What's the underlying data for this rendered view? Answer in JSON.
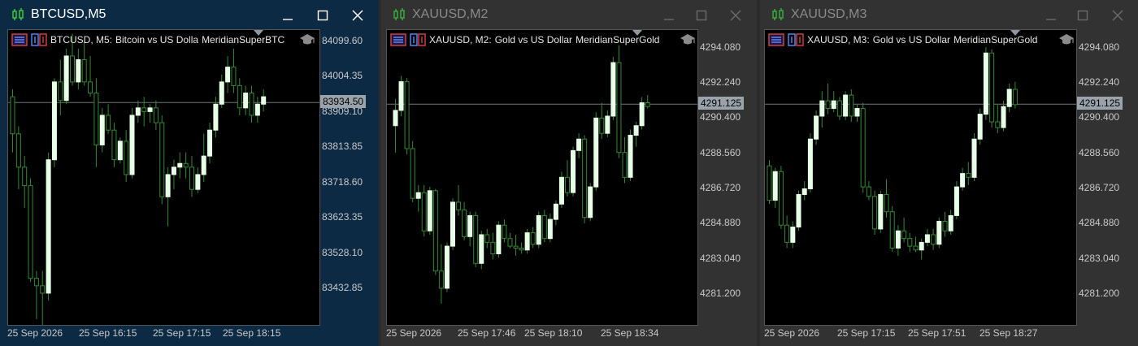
{
  "colors": {
    "active_title_bg": "#0d2a45",
    "inactive_title_bg": "#323232",
    "bull_candle": "#e8ffe8",
    "bear_candle": "#000000",
    "wick": "#2e8b2e",
    "price_line": "#6e7478",
    "price_tag_bg": "#9aa3ab"
  },
  "windows": [
    {
      "id": "btc",
      "title": "BTCUSD,M5",
      "active": true,
      "header": {
        "symbol": "BTCUSD, M5:",
        "description": "Bitcoin vs US Dolla",
        "indicator": "MeridianSuperBTC"
      },
      "price_ticks": [
        "84099.60",
        "84004.35",
        "83909.10",
        "83813.85",
        "83718.60",
        "83623.35",
        "83528.10",
        "83432.85"
      ],
      "current_price": "83934.50",
      "time_labels": [
        "25 Sep 2026",
        "25 Sep 16:15",
        "25 Sep 17:15",
        "25 Sep 18:15"
      ],
      "chart_data": {
        "type": "candlestick",
        "ylim": [
          83330,
          84130
        ],
        "current_price": 83934.5,
        "candles": [
          [
            83950,
            83970,
            83800,
            83850
          ],
          [
            83850,
            83870,
            83700,
            83760
          ],
          [
            83760,
            83790,
            83650,
            83710
          ],
          [
            83710,
            83730,
            83450,
            83460
          ],
          [
            83460,
            83480,
            83350,
            83440
          ],
          [
            83440,
            83480,
            83330,
            83420
          ],
          [
            83420,
            83800,
            83400,
            83780
          ],
          [
            83780,
            84000,
            83760,
            83990
          ],
          [
            83990,
            84050,
            83900,
            83940
          ],
          [
            83940,
            84080,
            83930,
            84060
          ],
          [
            84060,
            84120,
            83980,
            83990
          ],
          [
            83990,
            84080,
            83970,
            84050
          ],
          [
            84050,
            84100,
            83980,
            83990
          ],
          [
            83990,
            84060,
            83950,
            83960
          ],
          [
            83960,
            84000,
            83760,
            83820
          ],
          [
            83820,
            83920,
            83800,
            83900
          ],
          [
            83900,
            83930,
            83850,
            83860
          ],
          [
            83860,
            83880,
            83760,
            83780
          ],
          [
            83780,
            83840,
            83770,
            83830
          ],
          [
            83830,
            83860,
            83720,
            83740
          ],
          [
            83740,
            83920,
            83730,
            83900
          ],
          [
            83900,
            83940,
            83880,
            83920
          ],
          [
            83920,
            83950,
            83870,
            83910
          ],
          [
            83910,
            83930,
            83880,
            83920
          ],
          [
            83920,
            83940,
            83860,
            83880
          ],
          [
            83880,
            83900,
            83660,
            83680
          ],
          [
            83680,
            83760,
            83600,
            83740
          ],
          [
            83740,
            83780,
            83700,
            83760
          ],
          [
            83760,
            83800,
            83730,
            83770
          ],
          [
            83770,
            83800,
            83730,
            83760
          ],
          [
            83760,
            83790,
            83680,
            83700
          ],
          [
            83700,
            83760,
            83690,
            83740
          ],
          [
            83740,
            83850,
            83720,
            83790
          ],
          [
            83790,
            83880,
            83770,
            83860
          ],
          [
            83860,
            83950,
            83840,
            83930
          ],
          [
            83930,
            84010,
            83920,
            83990
          ],
          [
            83990,
            84060,
            83960,
            84030
          ],
          [
            84030,
            84080,
            83960,
            83980
          ],
          [
            83980,
            84000,
            83900,
            83920
          ],
          [
            83920,
            83980,
            83900,
            83960
          ],
          [
            83960,
            83980,
            83880,
            83900
          ],
          [
            83900,
            83950,
            83880,
            83930
          ],
          [
            83930,
            83970,
            83910,
            83950
          ]
        ]
      }
    },
    {
      "id": "xau2",
      "title": "XAUUSD,M2",
      "active": false,
      "header": {
        "symbol": "XAUUSD, M2:",
        "description": "Gold vs US Dollar",
        "indicator": "MeridianSuperGold"
      },
      "price_ticks": [
        "4294.080",
        "4292.240",
        "4290.400",
        "4288.560",
        "4286.720",
        "4284.880",
        "4283.040",
        "4281.200"
      ],
      "current_price": "4291.125",
      "time_labels": [
        "25 Sep 2026",
        "25 Sep 17:46",
        "25 Sep 18:10",
        "25 Sep 18:34"
      ],
      "chart_data": {
        "type": "candlestick",
        "ylim": [
          4279.5,
          4295.0
        ],
        "current_price": 4291.125,
        "candles": [
          [
            4290.0,
            4291.4,
            4288.6,
            4290.8
          ],
          [
            4290.8,
            4292.6,
            4290.5,
            4292.3
          ],
          [
            4292.3,
            4292.5,
            4288.5,
            4288.8
          ],
          [
            4288.8,
            4289.2,
            4286.0,
            4286.2
          ],
          [
            4286.2,
            4286.9,
            4285.5,
            4286.5
          ],
          [
            4286.5,
            4286.9,
            4284.2,
            4284.5
          ],
          [
            4284.5,
            4286.8,
            4284.3,
            4286.6
          ],
          [
            4286.6,
            4286.7,
            4282.2,
            4282.4
          ],
          [
            4282.4,
            4283.8,
            4280.7,
            4281.5
          ],
          [
            4281.5,
            4283.9,
            4281.3,
            4283.7
          ],
          [
            4283.7,
            4286.2,
            4283.5,
            4286.0
          ],
          [
            4286.0,
            4286.9,
            4285.3,
            4285.6
          ],
          [
            4285.6,
            4286.0,
            4284.0,
            4284.2
          ],
          [
            4284.2,
            4285.5,
            4283.7,
            4285.3
          ],
          [
            4285.3,
            4285.5,
            4282.6,
            4282.8
          ],
          [
            4282.8,
            4284.5,
            4282.5,
            4284.3
          ],
          [
            4284.3,
            4284.6,
            4283.6,
            4283.9
          ],
          [
            4283.9,
            4284.4,
            4283.0,
            4283.3
          ],
          [
            4283.3,
            4285.0,
            4283.1,
            4284.8
          ],
          [
            4284.8,
            4285.1,
            4283.9,
            4284.1
          ],
          [
            4284.1,
            4284.4,
            4283.6,
            4283.7
          ],
          [
            4283.7,
            4284.3,
            4283.2,
            4283.6
          ],
          [
            4283.6,
            4283.9,
            4283.3,
            4283.5
          ],
          [
            4283.5,
            4284.6,
            4283.3,
            4284.4
          ],
          [
            4284.4,
            4284.7,
            4283.6,
            4283.8
          ],
          [
            4283.8,
            4285.5,
            4283.6,
            4285.3
          ],
          [
            4285.3,
            4285.6,
            4283.9,
            4284.1
          ],
          [
            4284.1,
            4285.4,
            4283.9,
            4285.1
          ],
          [
            4285.1,
            4286.1,
            4284.8,
            4285.9
          ],
          [
            4285.9,
            4287.6,
            4285.7,
            4287.3
          ],
          [
            4287.3,
            4288.2,
            4286.3,
            4286.5
          ],
          [
            4286.5,
            4288.9,
            4286.3,
            4288.7
          ],
          [
            4288.7,
            4289.6,
            4288.3,
            4289.3
          ],
          [
            4289.3,
            4289.5,
            4284.9,
            4285.2
          ],
          [
            4285.2,
            4287.0,
            4285.0,
            4286.8
          ],
          [
            4286.8,
            4290.7,
            4286.6,
            4290.4
          ],
          [
            4290.4,
            4291.2,
            4289.3,
            4289.6
          ],
          [
            4289.6,
            4290.8,
            4289.4,
            4290.5
          ],
          [
            4290.5,
            4293.6,
            4290.3,
            4293.3
          ],
          [
            4293.3,
            4294.2,
            4288.3,
            4288.6
          ],
          [
            4288.6,
            4289.4,
            4287.0,
            4287.3
          ],
          [
            4287.3,
            4289.8,
            4287.1,
            4289.5
          ],
          [
            4289.5,
            4290.2,
            4288.9,
            4290.0
          ],
          [
            4290.0,
            4291.5,
            4289.8,
            4291.2
          ],
          [
            4291.2,
            4291.6,
            4290.9,
            4291.0
          ]
        ]
      }
    },
    {
      "id": "xau3",
      "title": "XAUUSD,M3",
      "active": false,
      "header": {
        "symbol": "XAUUSD, M3:",
        "description": "Gold vs US Dollar",
        "indicator": "MeridianSuperGold"
      },
      "price_ticks": [
        "4294.080",
        "4292.240",
        "4290.400",
        "4288.560",
        "4286.720",
        "4284.880",
        "4283.040",
        "4281.200"
      ],
      "current_price": "4291.125",
      "time_labels": [
        "25 Sep 2026",
        "25 Sep 17:15",
        "25 Sep 17:51",
        "25 Sep 18:27"
      ],
      "chart_data": {
        "type": "candlestick",
        "ylim": [
          4279.5,
          4295.0
        ],
        "current_price": 4291.125,
        "candles": [
          [
            4287.9,
            4288.2,
            4285.9,
            4286.1
          ],
          [
            4286.1,
            4287.8,
            4285.7,
            4287.6
          ],
          [
            4287.6,
            4287.9,
            4284.6,
            4284.8
          ],
          [
            4284.8,
            4285.3,
            4283.6,
            4283.9
          ],
          [
            4283.9,
            4285.0,
            4283.6,
            4284.7
          ],
          [
            4284.7,
            4286.6,
            4284.5,
            4286.4
          ],
          [
            4286.4,
            4287.1,
            4286.1,
            4286.7
          ],
          [
            4286.7,
            4289.6,
            4286.5,
            4289.3
          ],
          [
            4289.3,
            4290.8,
            4289.0,
            4290.5
          ],
          [
            4290.5,
            4291.8,
            4289.9,
            4291.3
          ],
          [
            4291.3,
            4292.2,
            4290.6,
            4290.9
          ],
          [
            4290.9,
            4291.8,
            4290.7,
            4291.3
          ],
          [
            4291.3,
            4291.5,
            4290.3,
            4290.5
          ],
          [
            4290.5,
            4291.8,
            4290.3,
            4291.6
          ],
          [
            4291.6,
            4291.9,
            4290.2,
            4290.5
          ],
          [
            4290.5,
            4291.1,
            4290.2,
            4290.9
          ],
          [
            4290.9,
            4291.2,
            4286.5,
            4286.8
          ],
          [
            4286.8,
            4287.1,
            4286.1,
            4286.3
          ],
          [
            4286.3,
            4286.6,
            4284.3,
            4284.6
          ],
          [
            4284.6,
            4286.6,
            4284.4,
            4286.4
          ],
          [
            4286.4,
            4287.2,
            4285.2,
            4285.5
          ],
          [
            4285.5,
            4285.8,
            4283.4,
            4283.6
          ],
          [
            4283.6,
            4284.8,
            4283.2,
            4284.5
          ],
          [
            4284.5,
            4285.2,
            4283.9,
            4284.1
          ],
          [
            4284.1,
            4284.4,
            4283.4,
            4283.7
          ],
          [
            4283.7,
            4284.2,
            4283.4,
            4283.5
          ],
          [
            4283.5,
            4284.1,
            4283.0,
            4283.9
          ],
          [
            4283.9,
            4284.6,
            4283.7,
            4284.3
          ],
          [
            4284.3,
            4284.6,
            4283.5,
            4283.8
          ],
          [
            4283.8,
            4285.2,
            4283.6,
            4285.0
          ],
          [
            4285.0,
            4285.5,
            4284.2,
            4284.5
          ],
          [
            4284.5,
            4285.6,
            4284.3,
            4285.3
          ],
          [
            4285.3,
            4287.1,
            4285.1,
            4286.8
          ],
          [
            4286.8,
            4287.8,
            4286.6,
            4287.5
          ],
          [
            4287.5,
            4288.1,
            4286.9,
            4287.3
          ],
          [
            4287.3,
            4289.6,
            4287.1,
            4289.3
          ],
          [
            4289.3,
            4290.9,
            4289.0,
            4290.6
          ],
          [
            4290.6,
            4294.1,
            4290.3,
            4293.8
          ],
          [
            4293.8,
            4294.0,
            4289.9,
            4290.2
          ],
          [
            4290.2,
            4291.1,
            4289.6,
            4289.9
          ],
          [
            4289.9,
            4291.3,
            4289.7,
            4291.0
          ],
          [
            4291.0,
            4292.2,
            4290.7,
            4291.9
          ],
          [
            4291.9,
            4292.3,
            4290.9,
            4291.1
          ]
        ]
      }
    }
  ]
}
